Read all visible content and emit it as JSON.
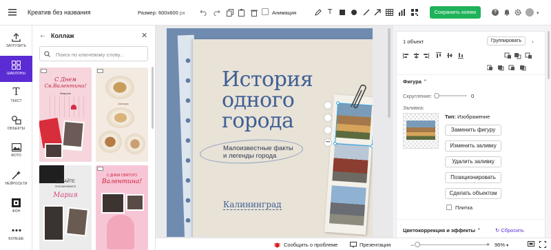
{
  "app": {
    "title": "Креатив без названия",
    "accent": "#5b2bd3",
    "save_color": "#1fb25a"
  },
  "topbar": {
    "size_label": "Размер:",
    "size_value": "600x600",
    "size_unit": "px",
    "animation_label": "Анимация",
    "save_button": "Сохранить копию"
  },
  "leftbar": {
    "items": [
      {
        "label": "ЗАГРУЗИТЬ",
        "icon": "upload-icon"
      },
      {
        "label": "ШАБЛОНЫ",
        "icon": "templates-icon",
        "active": true
      },
      {
        "label": "ТЕКСТ",
        "icon": "text-icon"
      },
      {
        "label": "ОБЪЕКТЫ",
        "icon": "shapes-icon"
      },
      {
        "label": "ФОТО",
        "icon": "photo-icon"
      },
      {
        "label": "НЕЙРОСЕТИ",
        "icon": "ai-icon"
      },
      {
        "label": "ФОН",
        "icon": "background-icon"
      },
      {
        "label": "БОЛЬШЕ",
        "icon": "more-icon"
      }
    ]
  },
  "panel": {
    "title": "Коллаж",
    "search_placeholder": "Поиск по ключевому слову...",
    "thumbs": [
      {
        "t1": "С Днем",
        "t2": "Св.Валентина!",
        "t3": "Февраль"
      },
      {
        "t1": "Завтрак"
      },
      {
        "t1": "ДАВАЙТЕ",
        "t2": "ПОЗНАКОМИМСЯ",
        "t3": "Мария"
      },
      {
        "t1": "С ДНЕМ СВЯТОГО",
        "t2": "Валентина!"
      }
    ]
  },
  "canvas": {
    "title_line1": "История",
    "title_line2": "одного",
    "title_line3": "города",
    "subtitle_line1": "Малоизвестные факты",
    "subtitle_line2": "и легенды города",
    "city": "Калининград"
  },
  "rightpanel": {
    "selection": "1 объект",
    "group_button": "Группировать",
    "shape_section": "Фигура",
    "rounding_label": "Скругление:",
    "rounding_value": "0",
    "fill_label": "Заливка:",
    "type_label": "Тип:",
    "type_value": "Изображение",
    "buttons": [
      "Заменить фигуру",
      "Изменить заливку",
      "Удалить заливку",
      "Позиционировать",
      "Сделать объектом"
    ],
    "tile_label": "Плитка",
    "color_section": "Цветокоррекция и эффекты",
    "reset_label": "Сбросить"
  },
  "bottombar": {
    "report": "Сообщить о проблеме",
    "presentation": "Презентация",
    "zoom": "96%"
  }
}
